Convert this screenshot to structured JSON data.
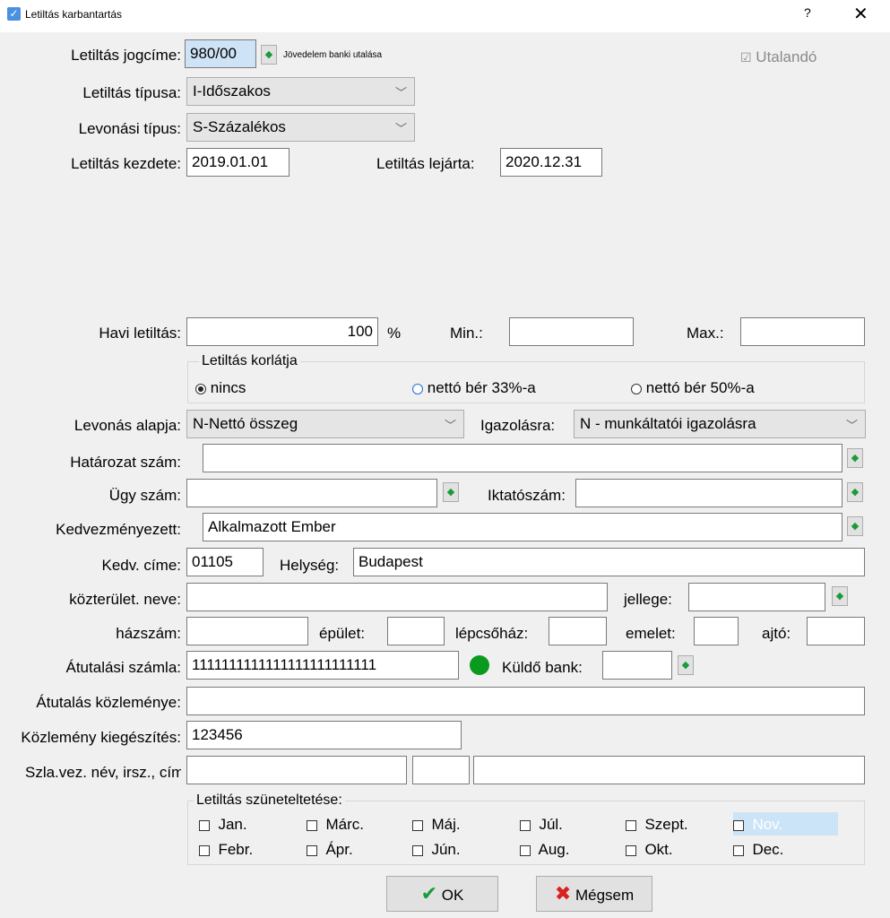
{
  "window": {
    "title": "Letiltás karbantartás",
    "help": "?",
    "close": "✕"
  },
  "form": {
    "jogcime_label": "Letiltás jogcíme:",
    "jogcime_value": "980/00",
    "jogcime_desc": "Jövedelem banki utalása",
    "utalando_label": "Utalandó",
    "tipusa_label": "Letiltás típusa:",
    "tipusa_value": "I-Időszakos",
    "levonasi_label": "Levonási típus:",
    "levonasi_value": "S-Százalékos",
    "kezdete_label": "Letiltás kezdete:",
    "kezdete_value": "2019.01.01",
    "lejarta_label": "Letiltás lejárta:",
    "lejarta_value": "2020.12.31",
    "havi_label": "Havi letiltás:",
    "havi_value": "100",
    "havi_unit": "%",
    "min_label": "Min.:",
    "max_label": "Max.:",
    "korlat_label": "Letiltás korlátja",
    "korlat_opt1": "nincs",
    "korlat_opt2": "nettó bér 33%-a",
    "korlat_opt3": "nettó bér 50%-a",
    "alapja_label": "Levonás alapja:",
    "alapja_value": "N-Nettó összeg",
    "igazolasra_label": "Igazolásra:",
    "igazolasra_value": "N - munkáltatói igazolásra",
    "hatarozat_label": "Határozat szám:",
    "ugy_label": "Ügy szám:",
    "iktato_label": "Iktatószám:",
    "kedv_label": "Kedvezményezett:",
    "kedv_value": "Alkalmazott Ember",
    "kedvcime_label": "Kedv. címe:",
    "kedvcime_value": "01105",
    "helyseg_label": "Helység:",
    "helyseg_value": "Budapest",
    "kozterulet_label": "közterület. neve:",
    "jellege_label": "jellege:",
    "hazszam_label": "házszám:",
    "epulet_label": "épület:",
    "lepcsohaz_label": "lépcsőház:",
    "emelet_label": "emelet:",
    "ajto_label": "ajtó:",
    "szamla_label": "Átutalási számla:",
    "szamla_value": "1111111111111111111111111",
    "kuldo_label": "Küldő bank:",
    "kozlemeny_label": "Átutalás közleménye:",
    "kiegeszites_label": "Közlemény kiegészítés:",
    "kiegeszites_value": "123456",
    "szlavez_label": "Szla.vez. név, irsz., cím:",
    "szunet_label": "Letiltás szüneteltetése:"
  },
  "months": [
    "Jan.",
    "Márc.",
    "Máj.",
    "Júl.",
    "Szept.",
    "Nov.",
    "Febr.",
    "Ápr.",
    "Jún.",
    "Aug.",
    "Okt.",
    "Dec."
  ],
  "buttons": {
    "ok": "OK",
    "cancel": "Mégsem"
  },
  "colors": {
    "status_dot": "#0a9b1e",
    "ok_check": "#1a9b3a",
    "cancel_x": "#d92020"
  }
}
